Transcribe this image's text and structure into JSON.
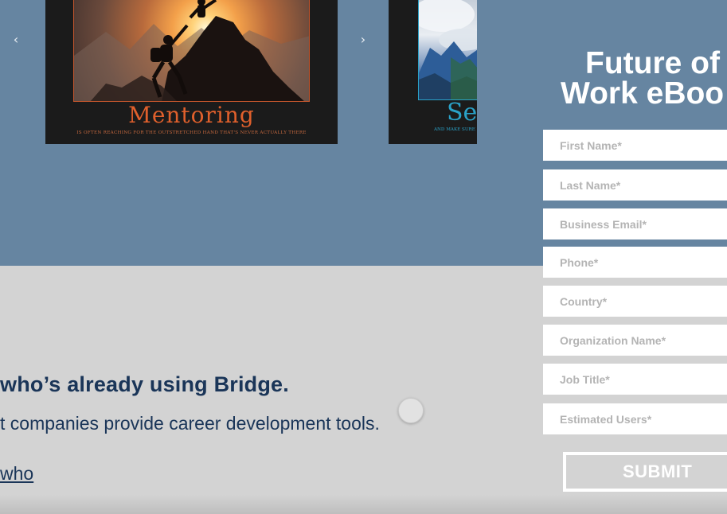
{
  "carousel": {
    "prev_icon": "chevron-left-icon",
    "next_icon": "chevron-right-icon",
    "posters": [
      {
        "title": "Mentoring",
        "tagline": "Is often reaching for the outstretched hand that's never actually there"
      },
      {
        "title": "Se",
        "tagline": "And make sure"
      }
    ]
  },
  "promo": {
    "headline": "who’s already using Bridge.",
    "subline": "t companies provide career development tools.",
    "link": "who"
  },
  "form": {
    "title_line1": "Future of",
    "title_line2": "Work eBoo",
    "fields": [
      {
        "placeholder": "First Name*"
      },
      {
        "placeholder": "Last Name*"
      },
      {
        "placeholder": "Business Email*"
      },
      {
        "placeholder": "Phone*"
      },
      {
        "placeholder": "Country*"
      },
      {
        "placeholder": "Organization Name*"
      },
      {
        "placeholder": "Job Title*"
      },
      {
        "placeholder": "Estimated Users*"
      }
    ],
    "submit_label": "SUBMIT"
  },
  "colors": {
    "hero_bg": "#6685a1",
    "lower_bg": "#d3d3d3",
    "text_navy": "#1a3558",
    "mentoring_orange": "#e0602c",
    "poster_blue": "#2aa2c8"
  }
}
